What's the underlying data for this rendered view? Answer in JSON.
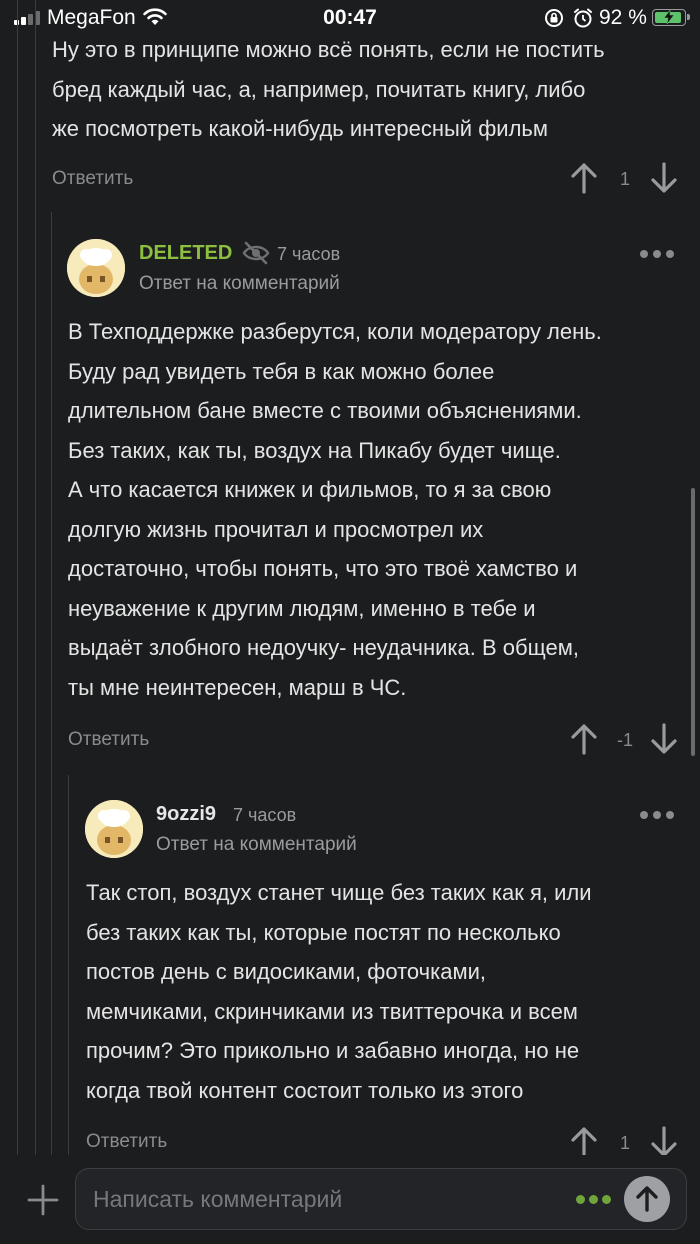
{
  "status_bar": {
    "carrier": "MegaFon",
    "time": "00:47",
    "battery_percent": "92 %",
    "battery_level": 0.92,
    "icons": [
      "signal-icon",
      "wifi-icon",
      "orientation-lock-icon",
      "alarm-icon",
      "battery-charging-icon"
    ]
  },
  "comments": [
    {
      "text": "Ну это в принципе можно всё понять, если не постить\nбред каждый час, а, например, почитать книгу, либо\nже посмотреть какой-нибудь интересный фильм",
      "reply_label": "Ответить",
      "score": "1"
    },
    {
      "author": "DELETED",
      "author_color": "#8cbf3f",
      "time": "7 часов",
      "reply_to": "Ответ на комментарий",
      "text": "В Техподдержке разберутся, коли модератору лень.\nБуду рад увидеть тебя в как можно более\nдлительном бане вместе с твоими объяснениями.\nБез таких, как ты, воздух на Пикабу будет чище.\n А что касается книжек и фильмов, то я за свою\nдолгую жизнь прочитал и просмотрел их\nдостаточно, чтобы понять, что это твоё хамство и\nнеуважение к другим людям, именно в тебе и\nвыдаёт злобного недоучку- неудачника. В общем,\nты мне неинтересен, марш в ЧС.",
      "reply_label": "Ответить",
      "score": "-1"
    },
    {
      "author": "9ozzi9",
      "author_color": "#e6e6e6",
      "time": "7 часов",
      "reply_to": "Ответ на комментарий",
      "text": "Так стоп, воздух станет чище без таких как я, или\nбез таких как ты, которые постят по несколько\nпостов день с видосиками, фоточками,\nмемчиками, скринчиками из твиттерочка и всем\nпрочим? Это прикольно и забавно иногда, но не\nкогда твой контент состоит только из этого",
      "reply_label": "Ответить",
      "score": "1"
    }
  ],
  "compose": {
    "placeholder": "Написать комментарий"
  },
  "colors": {
    "background": "#1c1d1f",
    "accent_green": "#8cbf3f",
    "muted": "#8a8b8d"
  }
}
